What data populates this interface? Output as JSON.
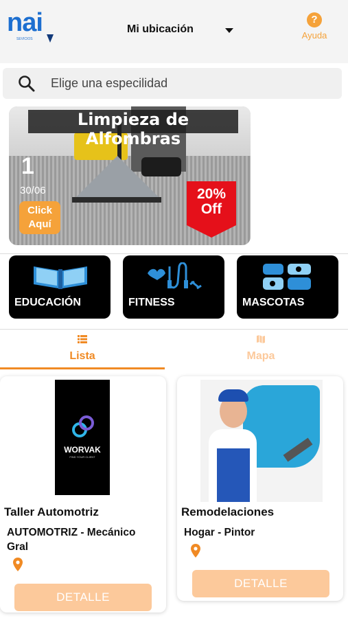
{
  "header": {
    "logo_text": "nai",
    "logo_subtext": "SEVICIOS",
    "location_label": "Mi ubicación",
    "help_label": "Ayuda",
    "help_glyph": "?"
  },
  "search": {
    "placeholder": "Elige una especilidad"
  },
  "banner": {
    "title": "Limpieza de Alfombras",
    "index": "1",
    "date": "30/06",
    "cta_line1": "Click",
    "cta_line2": "Aquí",
    "discount_line1": "20%",
    "discount_line2": "Off"
  },
  "categories": [
    {
      "label": "EDUCACIÓN",
      "icon": "book-icon"
    },
    {
      "label": "FITNESS",
      "icon": "jump-rope-icon"
    },
    {
      "label": "MASCOTAS",
      "icon": "pets-icon"
    }
  ],
  "tabs": [
    {
      "label": "Lista",
      "icon": "list-icon",
      "active": true
    },
    {
      "label": "Mapa",
      "icon": "map-icon",
      "active": false
    }
  ],
  "listings": [
    {
      "title": "Taller Automotriz",
      "subtitle": "AUTOMOTRIZ - Mecánico Gral",
      "image_brand": "WORVAK",
      "image_tagline": "FIND YOUR CLIENT",
      "button": "DETALLE"
    },
    {
      "title": "Remodelaciones",
      "subtitle": "Hogar - Pintor",
      "button": "DETALLE"
    }
  ],
  "colors": {
    "accent": "#f08a24",
    "accent_light": "#fcc99b",
    "brand_blue": "#1d6fd0",
    "discount_red": "#e5101a"
  }
}
